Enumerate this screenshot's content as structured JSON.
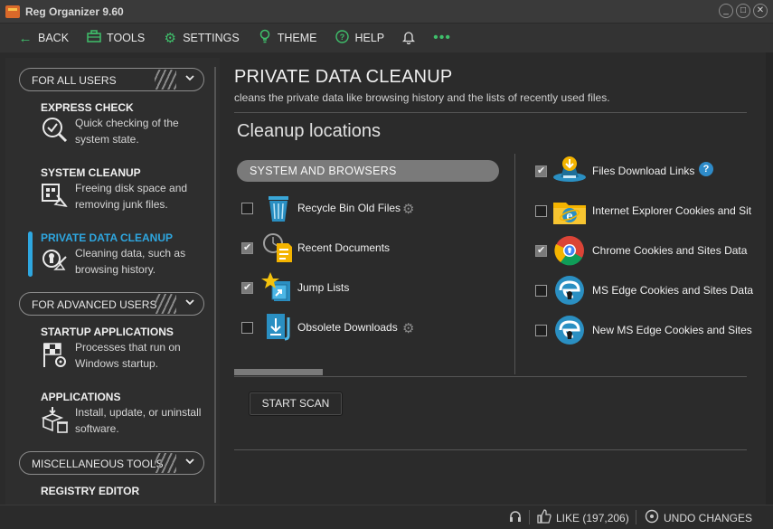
{
  "window": {
    "title": "Reg Organizer 9.60",
    "controls": [
      "_",
      "□",
      "✕"
    ]
  },
  "toolbar": {
    "back": "BACK",
    "tools": "TOOLS",
    "settings": "SETTINGS",
    "theme": "THEME",
    "help": "HELP",
    "more": "•••"
  },
  "sidebar": {
    "sections": [
      {
        "label": "FOR ALL USERS"
      },
      {
        "label": "FOR ADVANCED USERS"
      },
      {
        "label": "MISCELLANEOUS TOOLS"
      }
    ],
    "items": [
      {
        "title": "EXPRESS CHECK",
        "desc": "Quick checking of the system state."
      },
      {
        "title": "SYSTEM CLEANUP",
        "desc": "Freeing disk space and removing junk files."
      },
      {
        "title": "PRIVATE DATA CLEANUP",
        "desc": "Cleaning data, such as browsing history."
      },
      {
        "title": "STARTUP APPLICATIONS",
        "desc": "Processes that run on Windows startup."
      },
      {
        "title": "APPLICATIONS",
        "desc": "Install, update, or uninstall software."
      },
      {
        "title": "REGISTRY EDITOR",
        "desc": ""
      }
    ],
    "active_item": "PRIVATE DATA CLEANUP",
    "accent_color": "#2ea7e0"
  },
  "main": {
    "title": "PRIVATE DATA CLEANUP",
    "subtitle": "cleans the private data like browsing history and the lists of recently used files.",
    "section_title": "Cleanup locations",
    "group_label": "SYSTEM AND BROWSERS",
    "left_items": [
      {
        "label": "Recycle Bin Old Files",
        "checked": false,
        "icon": "recycle-bin-icon",
        "has_settings": true
      },
      {
        "label": "Recent Documents",
        "checked": true,
        "icon": "recent-documents-icon",
        "has_settings": false
      },
      {
        "label": "Jump Lists",
        "checked": true,
        "icon": "jump-lists-icon",
        "has_settings": false
      },
      {
        "label": "Obsolete Downloads",
        "checked": false,
        "icon": "obsolete-downloads-icon",
        "has_settings": true
      }
    ],
    "right_items": [
      {
        "label": "Files Download Links",
        "checked": true,
        "icon": "download-links-icon",
        "has_help": true
      },
      {
        "label": "Internet Explorer Cookies and Sit",
        "checked": false,
        "icon": "internet-explorer-icon"
      },
      {
        "label": "Chrome Cookies and Sites Data",
        "checked": true,
        "icon": "chrome-icon"
      },
      {
        "label": "MS Edge Cookies and Sites Data",
        "checked": false,
        "icon": "edge-icon"
      },
      {
        "label": "New MS Edge Cookies and Sites",
        "checked": false,
        "icon": "new-edge-icon"
      }
    ],
    "scan_button": "START SCAN"
  },
  "statusbar": {
    "like": "LIKE (197,206)",
    "undo": "UNDO CHANGES"
  }
}
